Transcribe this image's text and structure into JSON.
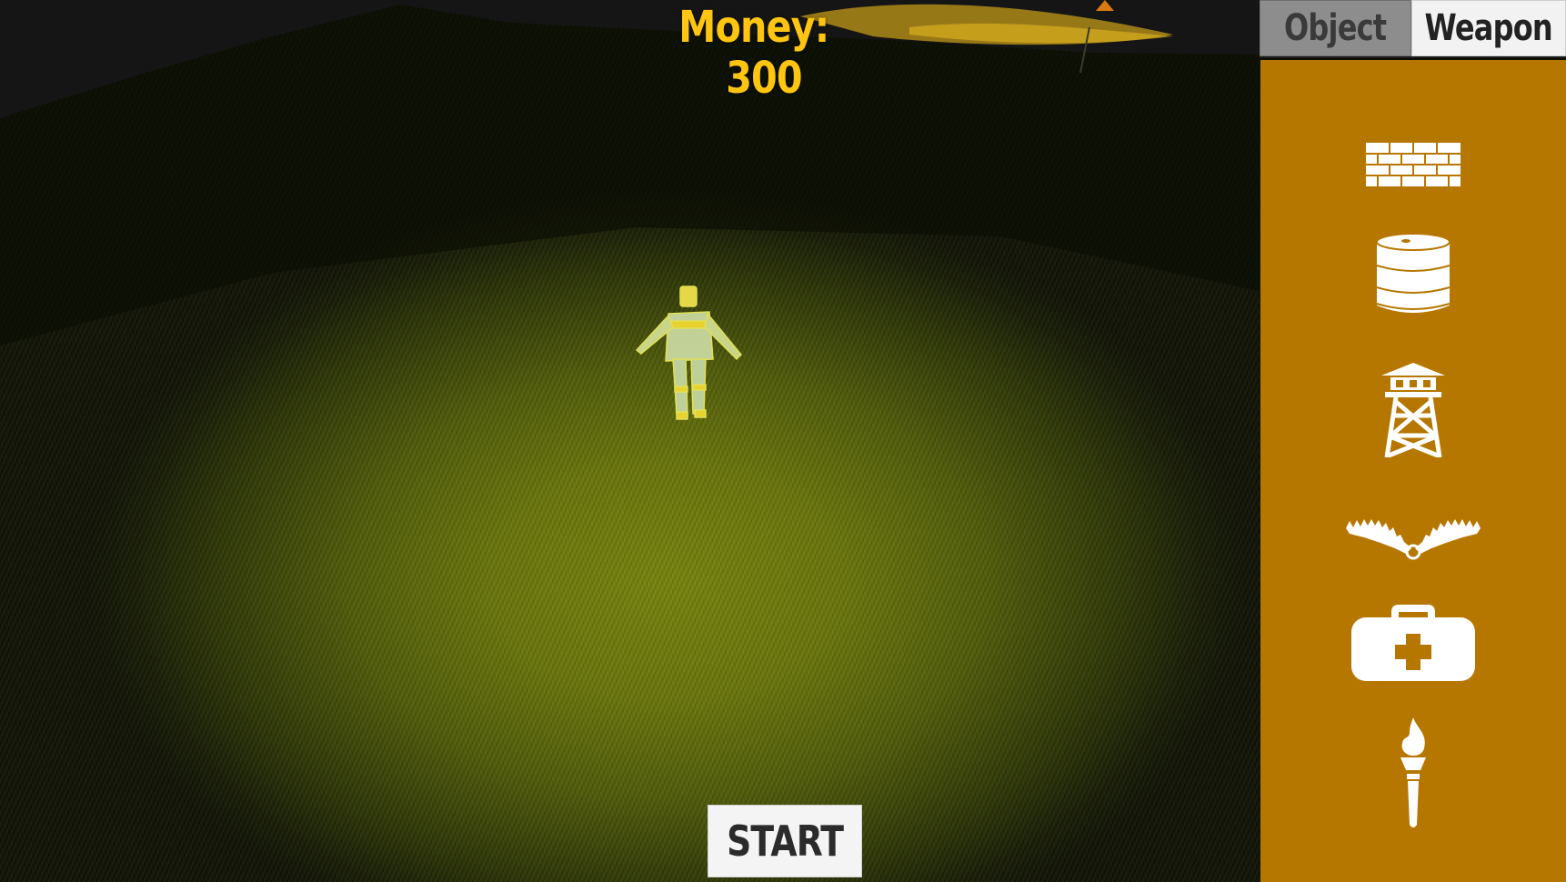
{
  "hud": {
    "money_label": "Money:",
    "money_value": "300"
  },
  "tabs": [
    {
      "label": "Object",
      "active": false
    },
    {
      "label": "Weapon",
      "active": true
    }
  ],
  "panel": {
    "items": [
      {
        "name": "brick-wall",
        "icon": "brick-wall-icon"
      },
      {
        "name": "barrel",
        "icon": "barrel-icon"
      },
      {
        "name": "watchtower",
        "icon": "watchtower-icon"
      },
      {
        "name": "bear-trap",
        "icon": "bear-trap-icon"
      },
      {
        "name": "medkit",
        "icon": "medkit-icon"
      },
      {
        "name": "torch",
        "icon": "torch-icon"
      }
    ]
  },
  "start_button": {
    "label": "START"
  },
  "colors": {
    "money": "#ffc510",
    "panel": "#b67701",
    "grass_lit": "#75820a",
    "tab_active": "#f2f2f2",
    "tab_inactive": "#8d8d8d"
  }
}
